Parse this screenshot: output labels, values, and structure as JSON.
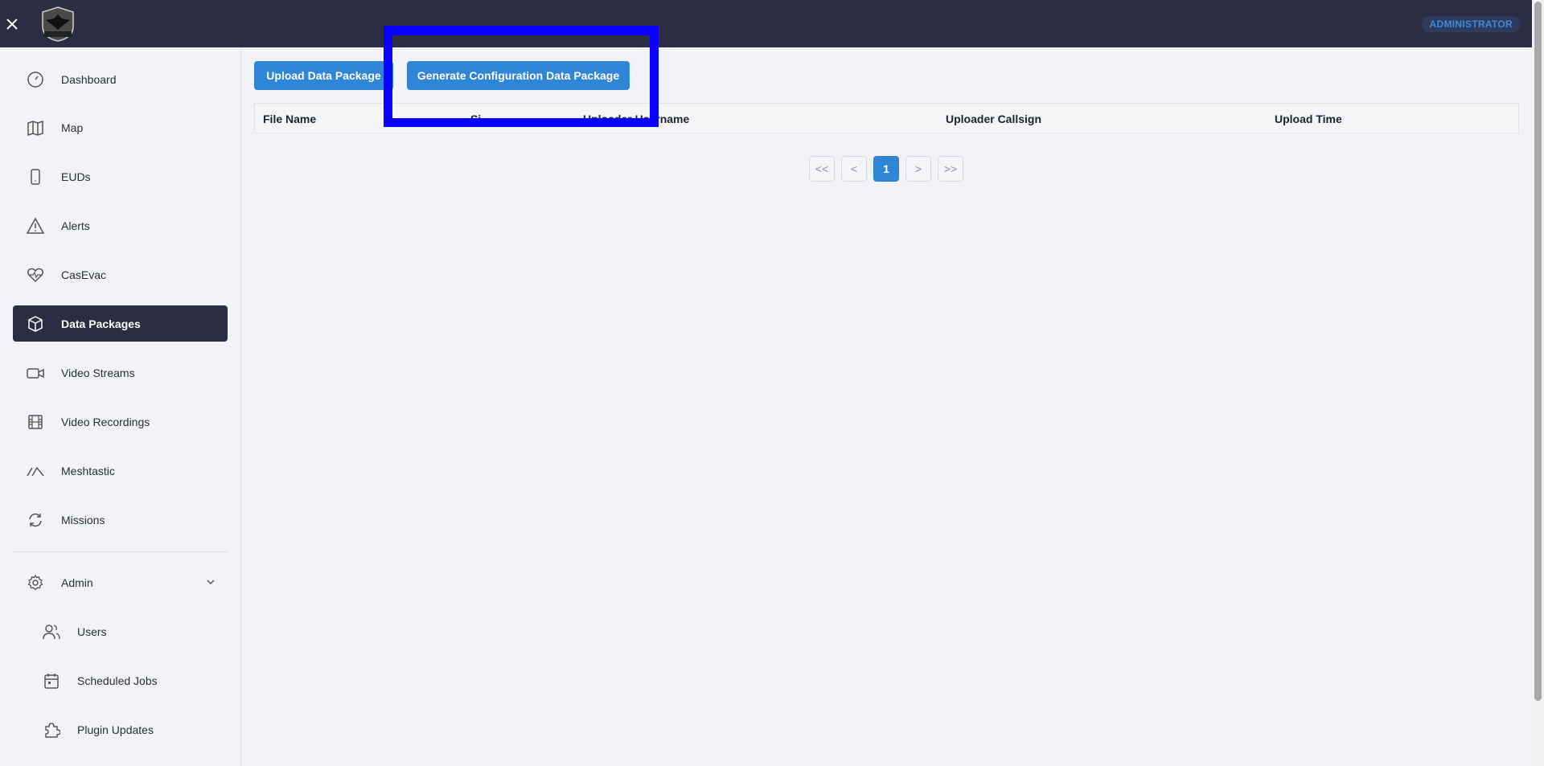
{
  "header": {
    "logo_alt": "OpenTAKServer",
    "role_badge": "ADMINISTRATOR"
  },
  "sidebar": {
    "items": [
      {
        "label": "Dashboard",
        "icon": "gauge-icon"
      },
      {
        "label": "Map",
        "icon": "map-icon"
      },
      {
        "label": "EUDs",
        "icon": "phone-icon"
      },
      {
        "label": "Alerts",
        "icon": "alert-icon"
      },
      {
        "label": "CasEvac",
        "icon": "heart-pulse-icon"
      },
      {
        "label": "Data Packages",
        "icon": "package-icon"
      },
      {
        "label": "Video Streams",
        "icon": "video-icon"
      },
      {
        "label": "Video Recordings",
        "icon": "film-icon"
      },
      {
        "label": "Meshtastic",
        "icon": "mesh-icon"
      },
      {
        "label": "Missions",
        "icon": "refresh-icon"
      }
    ],
    "admin": {
      "label": "Admin",
      "items": [
        {
          "label": "Users",
          "icon": "users-icon"
        },
        {
          "label": "Scheduled Jobs",
          "icon": "calendar-icon"
        },
        {
          "label": "Plugin Updates",
          "icon": "puzzle-icon"
        }
      ]
    }
  },
  "main": {
    "upload_label": "Upload Data Package",
    "generate_label": "Generate Configuration Data Package",
    "table": {
      "columns": [
        "File Name",
        "Si",
        "Uploader Username",
        "Uploader Callsign",
        "Upload Time"
      ]
    },
    "pagination": {
      "first": "<<",
      "prev": "<",
      "current": "1",
      "next": ">",
      "last": ">>"
    }
  },
  "colors": {
    "topbar": "#2b2d42",
    "accent": "#2f86d6",
    "highlight": "#0a00ff"
  }
}
